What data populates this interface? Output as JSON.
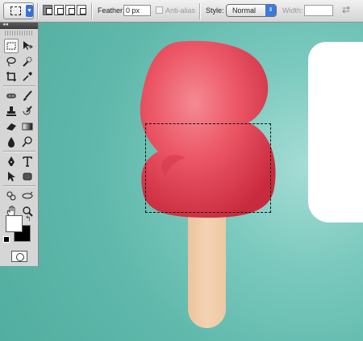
{
  "options_bar": {
    "feather_label": "Feather:",
    "feather_value": "0 px",
    "antialias_label": "Anti-alias",
    "antialias_checked": false,
    "style_label": "Style:",
    "style_value": "Normal",
    "width_label": "Width:",
    "width_value": ""
  },
  "tools": {
    "header_glyph": "◂◂",
    "items": [
      {
        "name": "rectangular-marquee-icon",
        "selected": true
      },
      {
        "name": "move-tool-icon"
      },
      {
        "name": "lasso-tool-icon"
      },
      {
        "name": "quick-selection-icon"
      },
      {
        "name": "crop-tool-icon"
      },
      {
        "name": "eyedropper-icon"
      },
      {
        "name": "spot-healing-icon"
      },
      {
        "name": "brush-tool-icon"
      },
      {
        "name": "clone-stamp-icon"
      },
      {
        "name": "history-brush-icon"
      },
      {
        "name": "eraser-icon"
      },
      {
        "name": "gradient-tool-icon"
      },
      {
        "name": "blur-tool-icon"
      },
      {
        "name": "dodge-tool-icon"
      },
      {
        "name": "pen-tool-icon"
      },
      {
        "name": "type-tool-icon"
      },
      {
        "name": "path-selection-icon"
      },
      {
        "name": "shape-tool-icon"
      },
      {
        "name": "3d-rotate-icon"
      },
      {
        "name": "3d-orbit-icon"
      },
      {
        "name": "hand-tool-icon"
      },
      {
        "name": "zoom-tool-icon"
      }
    ],
    "foreground_color": "#ffffff",
    "background_color": "#000000"
  },
  "canvas": {
    "background_color": "#5fb8ab",
    "popsicle_color": "#e84a5a",
    "stick_color": "#f2cfae"
  }
}
